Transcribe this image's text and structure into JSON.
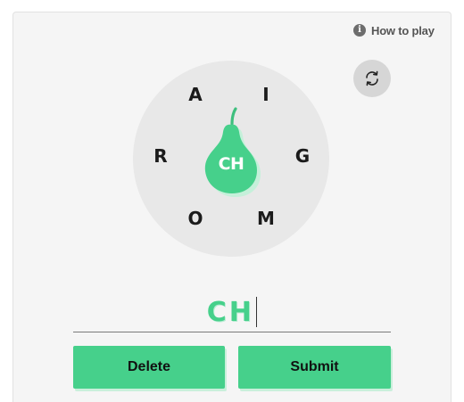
{
  "help": {
    "label": "How to play",
    "icon": "info-icon"
  },
  "shuffle": {
    "icon": "shuffle-icon"
  },
  "puzzle": {
    "center_letters": "CH",
    "outer_letters": [
      {
        "id": "a",
        "letter": "A"
      },
      {
        "id": "i",
        "letter": "I"
      },
      {
        "id": "r",
        "letter": "R"
      },
      {
        "id": "g",
        "letter": "G"
      },
      {
        "id": "o",
        "letter": "O"
      },
      {
        "id": "m",
        "letter": "M"
      }
    ]
  },
  "entry": {
    "current": "CH"
  },
  "actions": {
    "delete_label": "Delete",
    "submit_label": "Submit"
  },
  "colors": {
    "accent": "#46d08b",
    "wheel_bg": "#e8e8e8",
    "panel_bg": "#f5f5f5"
  }
}
